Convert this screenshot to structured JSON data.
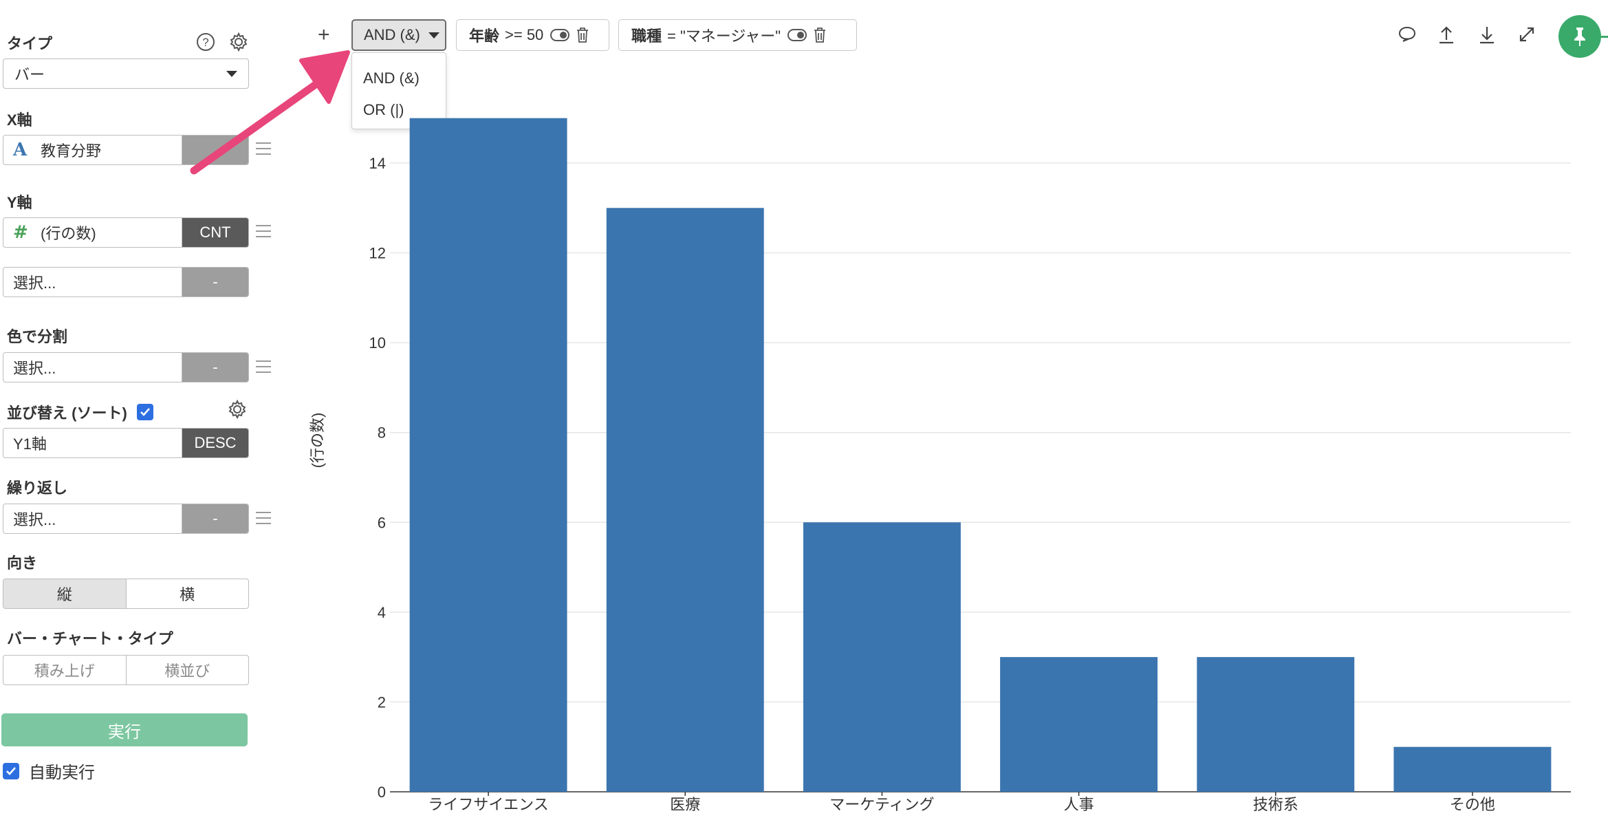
{
  "sidebar": {
    "type_label": "タイプ",
    "type_value": "バー",
    "x_axis_label": "X軸",
    "x_field": {
      "type_icon": "A",
      "name": "教育分野",
      "agg": ""
    },
    "y_axis_label": "Y軸",
    "y_field": {
      "type_icon": "#",
      "name": "(行の数)",
      "agg": "CNT"
    },
    "y_field2": {
      "name": "選択...",
      "agg": "-"
    },
    "color_label": "色で分割",
    "color_field": {
      "name": "選択...",
      "agg": "-"
    },
    "sort_label": "並び替え (ソート)",
    "sort_checked": true,
    "sort_field": {
      "name": "Y1軸",
      "agg": "DESC"
    },
    "repeat_label": "繰り返し",
    "repeat_field": {
      "name": "選択...",
      "agg": "-"
    },
    "orientation_label": "向き",
    "orientation_options": [
      "縦",
      "横"
    ],
    "orientation_selected": "縦",
    "bar_type_label": "バー・チャート・タイプ",
    "bar_type_options": [
      "積み上げ",
      "横並び"
    ],
    "run_label": "実行",
    "auto_run_label": "自動実行",
    "auto_run_checked": true
  },
  "toolbar": {
    "add": "+",
    "logic_button": "AND (&)",
    "logic_options": [
      "AND (&)",
      "OR (|)"
    ],
    "filters": [
      {
        "field": "年齢",
        "condition": ">= 50"
      },
      {
        "field": "職種",
        "condition": "= \"マネージャー\""
      }
    ]
  },
  "icons": {
    "help": "question-circle-icon",
    "settings": "gear-icon",
    "comment": "comment-icon",
    "upload": "upload-icon",
    "download": "download-icon",
    "expand": "expand-icon",
    "pin": "pin-icon",
    "eye": "toggle-icon",
    "trash": "trash-icon"
  },
  "colors": {
    "bar": "#3b75af",
    "run_button": "#7cc7a1",
    "pin_button": "#3aaa6b",
    "arrow": "#e8457a"
  },
  "chart_data": {
    "type": "bar",
    "categories": [
      "ライフサイエンス",
      "医療",
      "マーケティング",
      "人事",
      "技術系",
      "その他"
    ],
    "values": [
      15,
      13,
      6,
      3,
      3,
      1
    ],
    "ylabel": "(行の数)",
    "xlabel": "",
    "ylim": [
      0,
      15
    ],
    "yticks": [
      0,
      2,
      4,
      6,
      8,
      10,
      12,
      14
    ],
    "grid": true,
    "legend": "none"
  }
}
